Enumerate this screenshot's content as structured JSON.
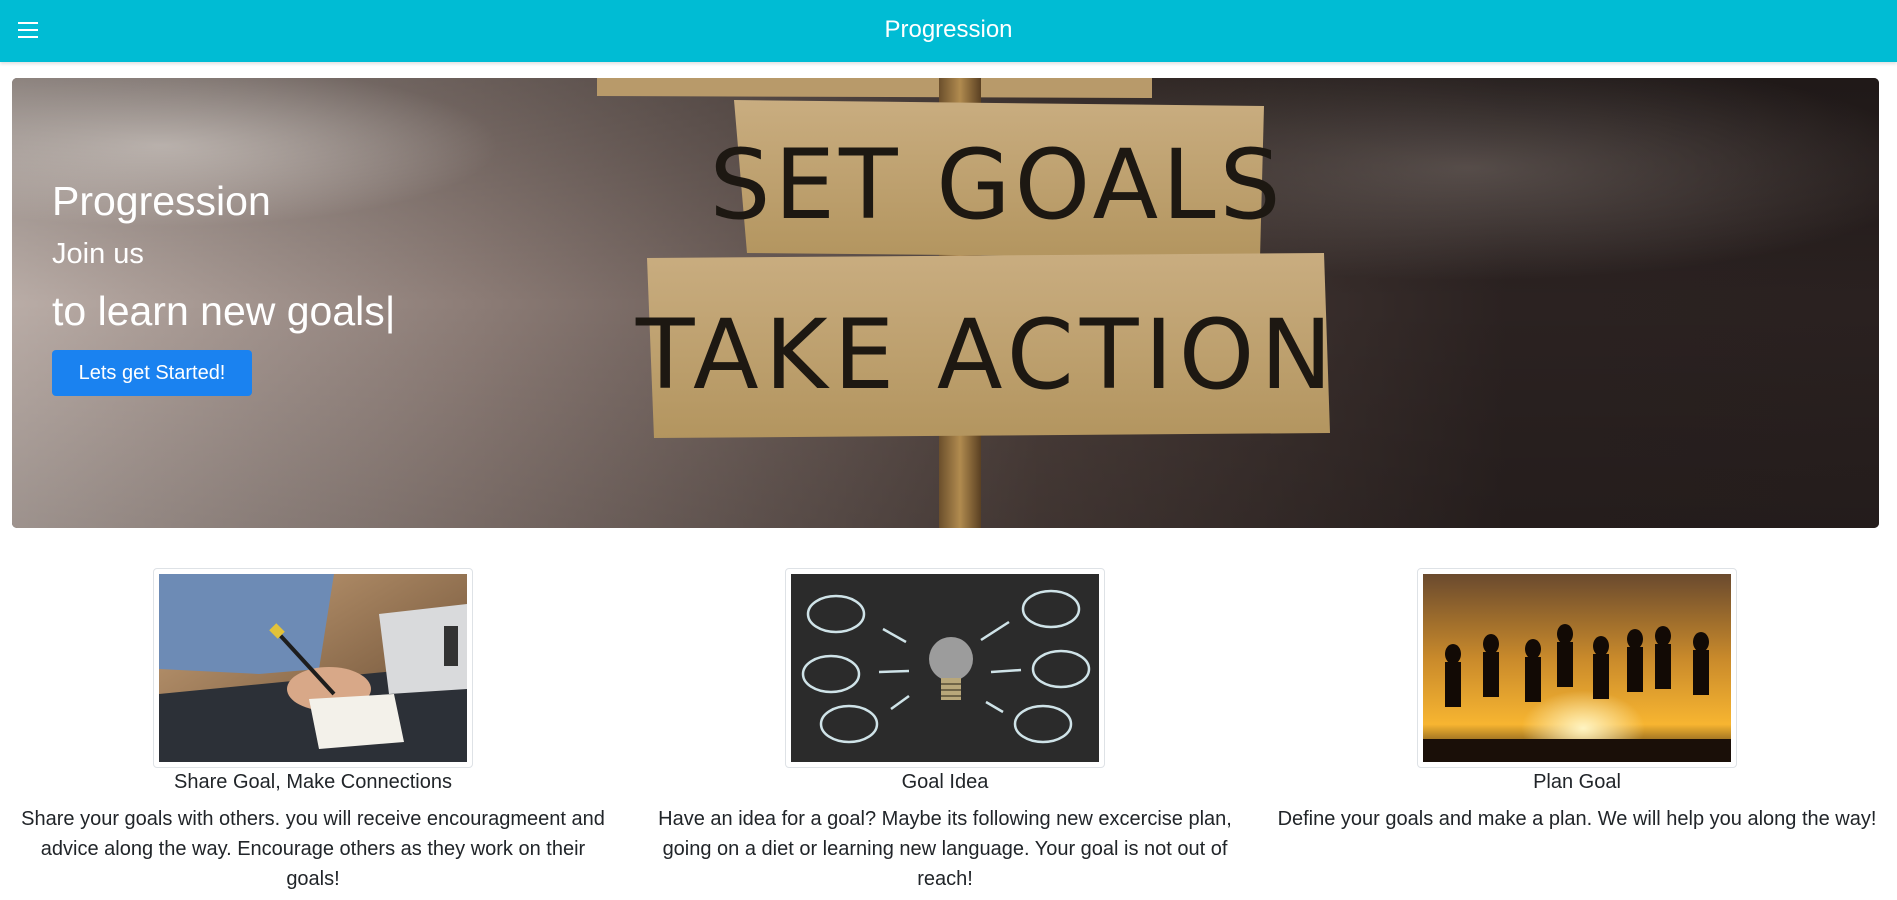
{
  "navbar": {
    "title": "Progression",
    "menu_icon": "hamburger-menu-icon",
    "background_color": "#00bcd4"
  },
  "hero": {
    "title": "Progression",
    "subtitle": "Join us",
    "typed_text": "to learn new goals",
    "cursor": "|",
    "button_label": "Lets get Started!",
    "button_color": "#1a82f0",
    "sign_top": "SET GOALS",
    "sign_bottom": "TAKE ACTION"
  },
  "features": [
    {
      "image": "person-writing-notes-image",
      "title": "Share Goal, Make Connections",
      "text": "Share your goals with others. you will receive encouragmeent and advice along the way. Encourage others as they work on their goals!"
    },
    {
      "image": "lightbulb-chalkboard-image",
      "title": "Goal Idea",
      "text": "Have an idea for a goal? Maybe its following new excercise plan, going on a diet or learning new language. Your goal is not out of reach!"
    },
    {
      "image": "people-jumping-sunset-image",
      "title": "Plan Goal",
      "text": "Define your goals and make a plan. We will help you along the way!"
    }
  ]
}
